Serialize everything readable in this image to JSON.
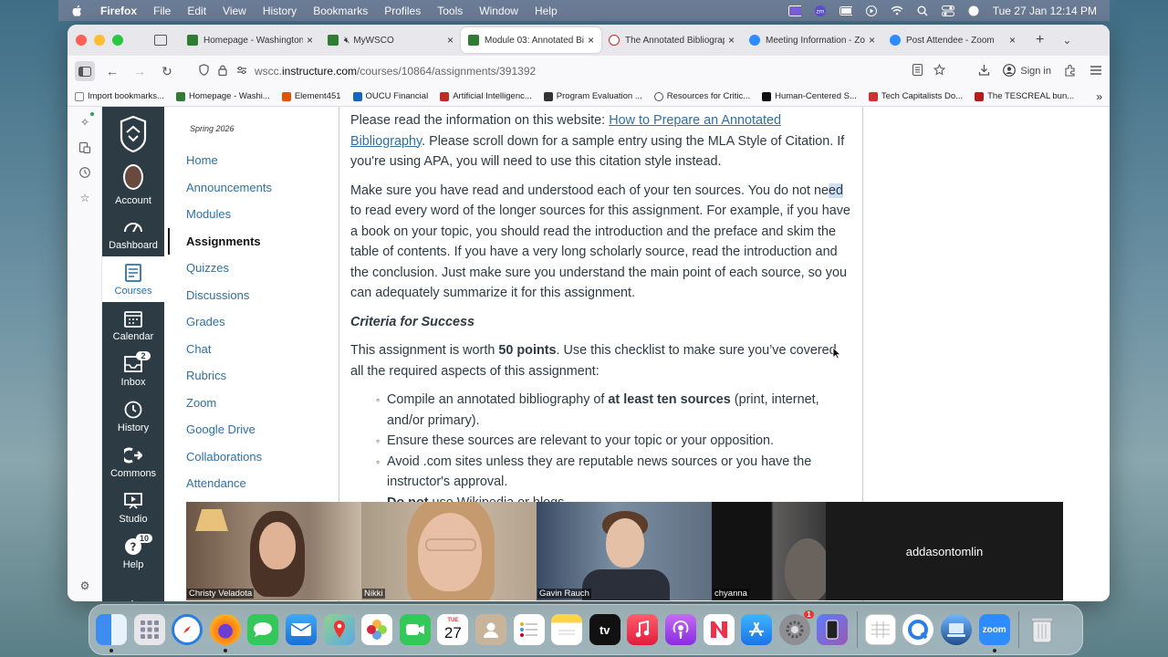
{
  "menubar": {
    "app": "Firefox",
    "items": [
      "File",
      "Edit",
      "View",
      "History",
      "Bookmarks",
      "Profiles",
      "Tools",
      "Window",
      "Help"
    ],
    "datetime": "Tue 27 Jan  12:14 PM"
  },
  "tabs": [
    {
      "label": "Homepage - Washington",
      "fav_color": "#2e7d32"
    },
    {
      "label": "MyWSCO",
      "fav_color": "#2e7d32"
    },
    {
      "label": "Module 03: Annotated Bi",
      "fav_color": "#2e7d32"
    },
    {
      "label": "The Annotated Bibliograp",
      "fav_color": "#c62828"
    },
    {
      "label": "Meeting Information - Zo",
      "fav_color": "#2d8cff"
    },
    {
      "label": "Post Attendee - Zoom",
      "fav_color": "#2d8cff"
    }
  ],
  "url": {
    "prefix": "wscc.",
    "host": "instructure.com",
    "path": "/courses/10864/assignments/391392"
  },
  "signin": "Sign in",
  "bookmarks": [
    {
      "label": "Import bookmarks...",
      "color": "#888"
    },
    {
      "label": "Homepage - Washi...",
      "color": "#2e7d32"
    },
    {
      "label": "Element451",
      "color": "#e65100"
    },
    {
      "label": "OUCU Financial",
      "color": "#1565c0"
    },
    {
      "label": "Artificial Intelligenc...",
      "color": "#c62828"
    },
    {
      "label": "Program Evaluation ...",
      "color": "#333"
    },
    {
      "label": "Resources for Critic...",
      "color": "#555"
    },
    {
      "label": "Human-Centered S...",
      "color": "#111"
    },
    {
      "label": "Tech Capitalists Do...",
      "color": "#d32f2f"
    },
    {
      "label": "The TESCREAL bun...",
      "color": "#b71c1c"
    }
  ],
  "global_nav": [
    {
      "label": "Account",
      "icon": "account-avatar"
    },
    {
      "label": "Dashboard",
      "icon": "dashboard-icon"
    },
    {
      "label": "Courses",
      "icon": "courses-icon",
      "active": true
    },
    {
      "label": "Calendar",
      "icon": "calendar-icon"
    },
    {
      "label": "Inbox",
      "icon": "inbox-icon",
      "badge": "2"
    },
    {
      "label": "History",
      "icon": "history-icon"
    },
    {
      "label": "Commons",
      "icon": "commons-icon"
    },
    {
      "label": "Studio",
      "icon": "studio-icon"
    },
    {
      "label": "Help",
      "icon": "help-icon",
      "badge": "10"
    }
  ],
  "course_nav": {
    "term": "Spring 2026",
    "items": [
      "Home",
      "Announcements",
      "Modules",
      "Assignments",
      "Quizzes",
      "Discussions",
      "Grades",
      "Chat",
      "Rubrics",
      "Zoom",
      "Google Drive",
      "Collaborations",
      "Attendance"
    ],
    "active": "Assignments"
  },
  "content": {
    "p1_pre": "Please read the information on this website: ",
    "p1_link": "How to Prepare an Annotated Bibliography",
    "p1_post": ". Please scroll down for a sample entry using the MLA Style of Citation. If you're using APA, you will need to use this citation style instead.",
    "p2_a": "Make sure you have read and understood each of your ten sources. You do not ne",
    "p2_hl": "ed",
    "p2_b": " to read every word of the longer sources for this assignment. For example, if you have a book on your topic, you should read the introduction and the preface and skim the table of contents. If you have a very long scholarly source, read the introduction and the conclusion. Just make sure you understand the main point of each source, so you can adequately summarize it for this assignment.",
    "criteria": "Criteria for Success",
    "p3_pre": "This assignment is worth ",
    "p3_bold": "50 points",
    "p3_post": ". Use this checklist to make sure you’ve covered all the required aspects of this assignment:",
    "li1_pre": "Compile an annotated bibliography of ",
    "li1_bold": "at least ten sources",
    "li1_post": " (print, internet, and/or primary).",
    "li2": "Ensure these sources are relevant to your topic or your opposition.",
    "li3": "Avoid .com sites unless they are reputable news sources or you have the instructor's approval.",
    "li4_bold": "Do not",
    "li4_post": " use Wikipedia or blogs."
  },
  "zoom": {
    "participants": [
      "Christy Veladota",
      "Nikki",
      "Gavin Rauch",
      "chyanna"
    ],
    "no_video_name": "addasontomlin"
  },
  "dock": {
    "calendar_day": "27",
    "calendar_month": "TUE",
    "settings_badge": "1",
    "appletv_label": "tv",
    "zoom_label": "zoom"
  }
}
